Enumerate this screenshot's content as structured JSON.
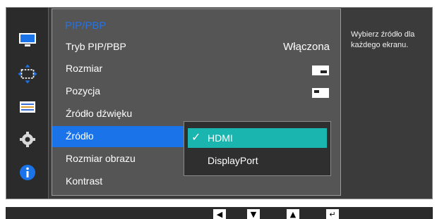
{
  "menu": {
    "title": "PIP/PBP",
    "rows": [
      {
        "label": "Tryb PIP/PBP",
        "value": "Włączona"
      },
      {
        "label": "Rozmiar"
      },
      {
        "label": "Pozycja"
      },
      {
        "label": "Źródło dźwięku"
      },
      {
        "label": "Źródło"
      },
      {
        "label": "Rozmiar obrazu"
      },
      {
        "label": "Kontrast"
      }
    ]
  },
  "popup": {
    "options": [
      {
        "label": "HDMI",
        "selected": true
      },
      {
        "label": "DisplayPort",
        "selected": false
      }
    ]
  },
  "help_text": "Wybierz źródło dla każdego ekranu.",
  "sidebar": {
    "icons": [
      "monitor-icon",
      "resize-icon",
      "adjust-bars-icon",
      "gear-icon",
      "info-icon"
    ]
  },
  "navigation_keys": [
    "left-arrow-key-icon",
    "down-arrow-key-icon",
    "up-arrow-key-icon",
    "enter-key-icon"
  ],
  "colors": {
    "accent": "#1a73e8",
    "selected": "#19b5ae",
    "title": "#2a72d9"
  }
}
